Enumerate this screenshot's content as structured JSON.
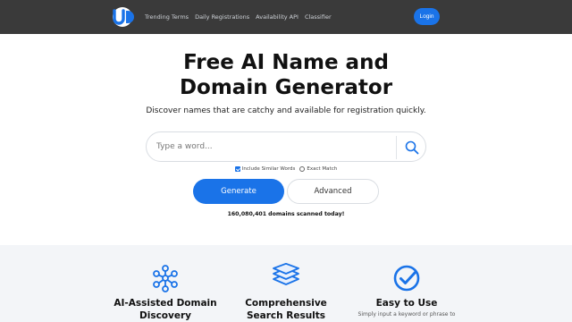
{
  "header": {
    "logo_alt": "UD",
    "nav": [
      "Trending Terms",
      "Daily Registrations",
      "Availability API",
      "Classifier"
    ],
    "login_label": "Login"
  },
  "hero": {
    "title_line1": "Free AI Name and",
    "title_line2": "Domain Generator",
    "subtitle": "Discover names that are catchy and available for registration quickly.",
    "search_placeholder": "Type a word...",
    "option_similar": "Include Similar Words",
    "option_similar_checked": true,
    "option_exact": "Exact Match",
    "option_exact_checked": false,
    "generate_label": "Generate",
    "advanced_label": "Advanced",
    "scanned_text": "160,080,401 domains scanned today!"
  },
  "features": [
    {
      "title_line1": "AI-Assisted Domain",
      "title_line2": "Discovery",
      "desc": "",
      "icon": "network-icon"
    },
    {
      "title_line1": "Comprehensive",
      "title_line2": "Search Results",
      "desc": "",
      "icon": "layers-icon"
    },
    {
      "title_line1": "Easy to Use",
      "title_line2": "",
      "desc": "Simply input a keyword or phrase to",
      "icon": "check-circle-icon"
    }
  ],
  "colors": {
    "accent": "#1a73e8",
    "header_bg": "#3a3a3a",
    "features_bg": "#f3f5f8"
  }
}
